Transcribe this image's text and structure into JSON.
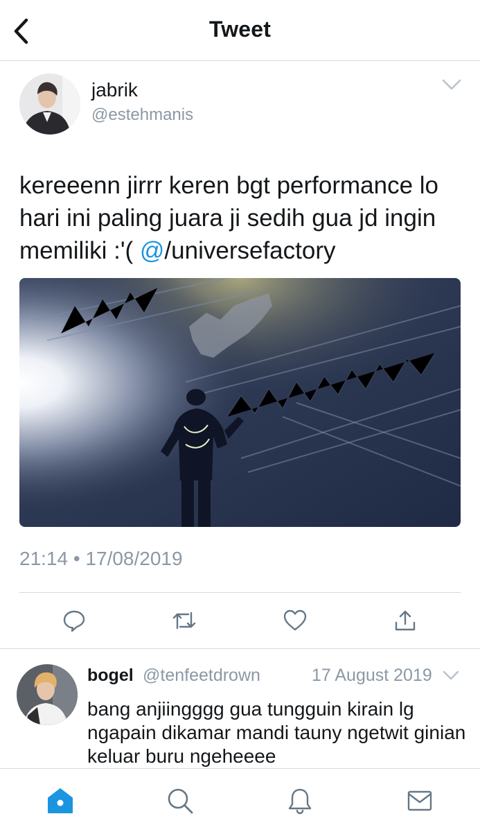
{
  "header": {
    "title": "Tweet",
    "back_icon": "chevron-left-icon"
  },
  "tweet": {
    "author_name": "jabrik",
    "author_handle": "@estehmanis",
    "text_main": "kereeenn jirrr keren bgt performance lo hari ini paling juara ji sedih gua jd ingin memiliki :'( ",
    "mention_at": "@",
    "mention_rest": "/universefactory",
    "timestamp": "21:14 • 17/08/2019",
    "actions": [
      "reply-icon",
      "retweet-icon",
      "like-icon",
      "share-icon"
    ]
  },
  "reply": {
    "name": "bogel",
    "handle": "@tenfeetdrown",
    "date": "17 August 2019",
    "text": "bang anjiingggg gua tungguin kirain lg ngapain dikamar mandi tauny ngetwit ginian keluar buru ngeheeee"
  },
  "tabbar": {
    "items": [
      "home-icon",
      "search-icon",
      "notifications-icon",
      "messages-icon"
    ],
    "active": "home-icon"
  },
  "colors": {
    "accent": "#1b95e0",
    "secondary_text": "#8b98a5",
    "icon_gray": "#657786",
    "divider": "#d6d9dc"
  }
}
